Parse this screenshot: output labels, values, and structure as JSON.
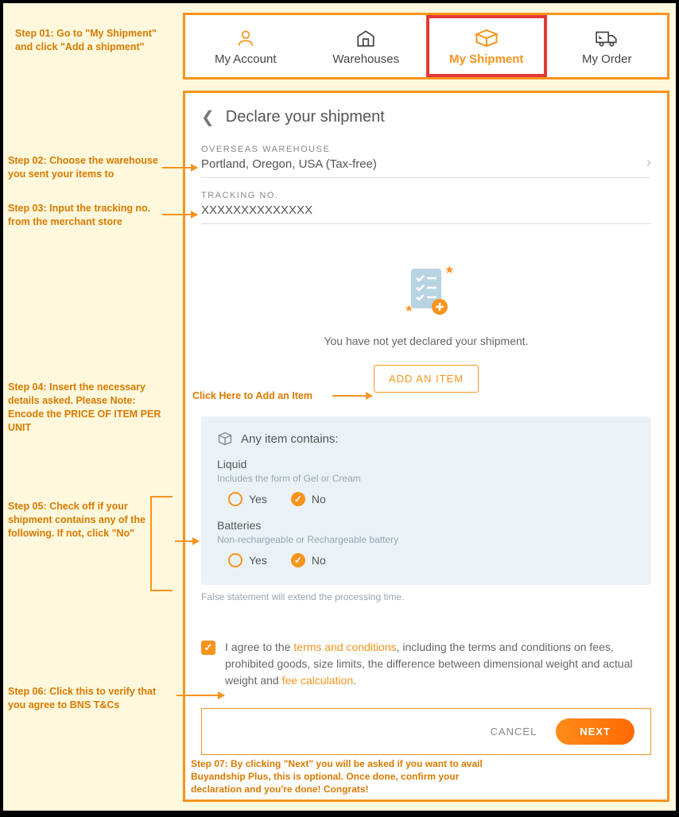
{
  "nav": {
    "items": [
      {
        "label": "My Account",
        "icon": "user-icon",
        "active": false
      },
      {
        "label": "Warehouses",
        "icon": "warehouse-icon",
        "active": false
      },
      {
        "label": "My Shipment",
        "icon": "package-icon",
        "active": true
      },
      {
        "label": "My Order",
        "icon": "truck-icon",
        "active": false
      }
    ]
  },
  "panel": {
    "title": "Declare your shipment",
    "warehouse": {
      "label": "OVERSEAS WAREHOUSE",
      "value": "Portland, Oregon, USA (Tax-free)"
    },
    "tracking": {
      "label": "TRACKING NO.",
      "value": "XXXXXXXXXXXXXX"
    },
    "empty_text": "You have not yet declared your shipment.",
    "add_item_label": "ADD AN ITEM",
    "contains": {
      "header": "Any item contains:",
      "groups": [
        {
          "title": "Liquid",
          "sub": "Includes the form of Gel or Cream",
          "options": {
            "yes": "Yes",
            "no": "No",
            "selected": "No"
          }
        },
        {
          "title": "Batteries",
          "sub": "Non-rechargeable or Rechargeable battery",
          "options": {
            "yes": "Yes",
            "no": "No",
            "selected": "No"
          }
        }
      ],
      "disclaimer": "False statement will extend the processing time."
    },
    "agree": {
      "prefix": "I agree to the ",
      "link1": "terms and conditions",
      "middle": ", including the terms and conditions on fees, prohibited goods, size limits, the difference between dimensional weight and actual weight and ",
      "link2": "fee calculation",
      "suffix": ".",
      "checked": true
    },
    "actions": {
      "cancel": "CANCEL",
      "next": "NEXT"
    }
  },
  "annotations": {
    "step1": "Step 01: Go to \"My Shipment\" and click \"Add a shipment\"",
    "step2": "Step 02: Choose the warehouse you sent your items to",
    "step3": "Step 03: Input the tracking no. from the merchant store",
    "step4": "Step 04: Insert the necessary details asked. Please Note: Encode the PRICE OF ITEM PER UNIT",
    "addhere": "Click Here to Add an Item",
    "step5": "Step 05: Check off if your shipment contains any of the following. If not, click \"No\"",
    "step6": "Step 06: Click this to verify that you agree to BNS T&Cs",
    "step7": "Step 07: By clicking \"Next\" you will be asked if you want to avail Buyandship Plus, this is optional. Once done, confirm your declaration and you're done! Congrats!"
  },
  "colors": {
    "accent": "#f7941d",
    "highlight": "#e53935"
  }
}
